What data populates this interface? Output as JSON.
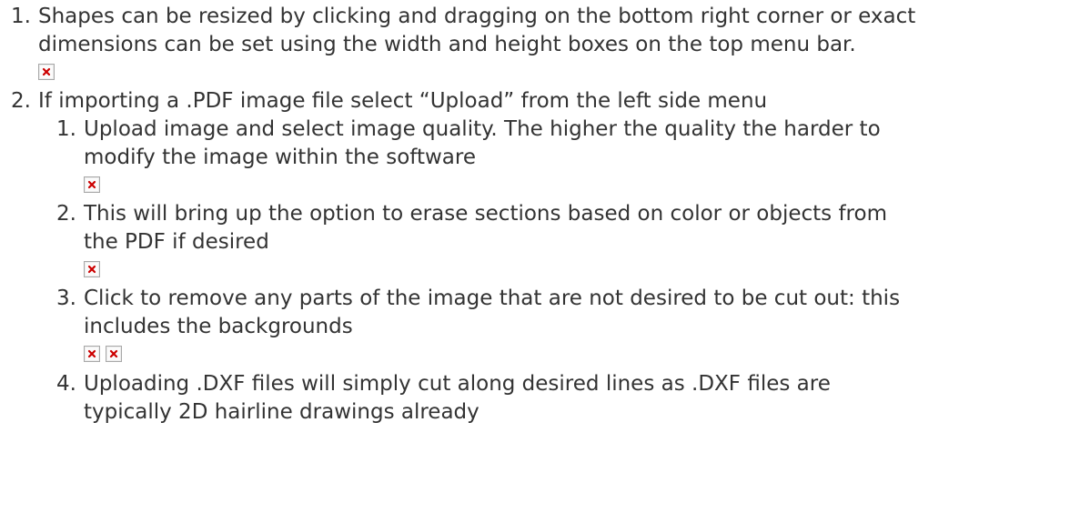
{
  "list": {
    "items": [
      {
        "number": "1.",
        "line1": "Shapes can be resized by clicking and dragging on the bottom right corner or exact",
        "line2": "dimensions can be set using the width and height boxes on the top menu bar."
      },
      {
        "number": "2.",
        "line1": "If importing a .PDF image file select “Upload” from the left side menu",
        "subitems": [
          {
            "number": "1.",
            "line1": "Upload image and select image quality. The higher the quality the harder to",
            "line2": "modify the image within the software"
          },
          {
            "number": "2.",
            "line1": "This will bring up the option to erase sections based on color or objects from",
            "line2": "the PDF if desired"
          },
          {
            "number": "3.",
            "line1": "Click to remove any parts of the image that are not desired to be cut out: this",
            "line2": "includes the backgrounds"
          },
          {
            "number": "4.",
            "line1": "Uploading .DXF files will simply cut along desired lines as .DXF files are",
            "line2": "typically 2D hairline drawings already"
          }
        ]
      }
    ]
  },
  "colors": {
    "text": "#333333",
    "broken_image_x": "#cc0000"
  },
  "icons": {
    "broken_image": "broken-image-icon"
  }
}
